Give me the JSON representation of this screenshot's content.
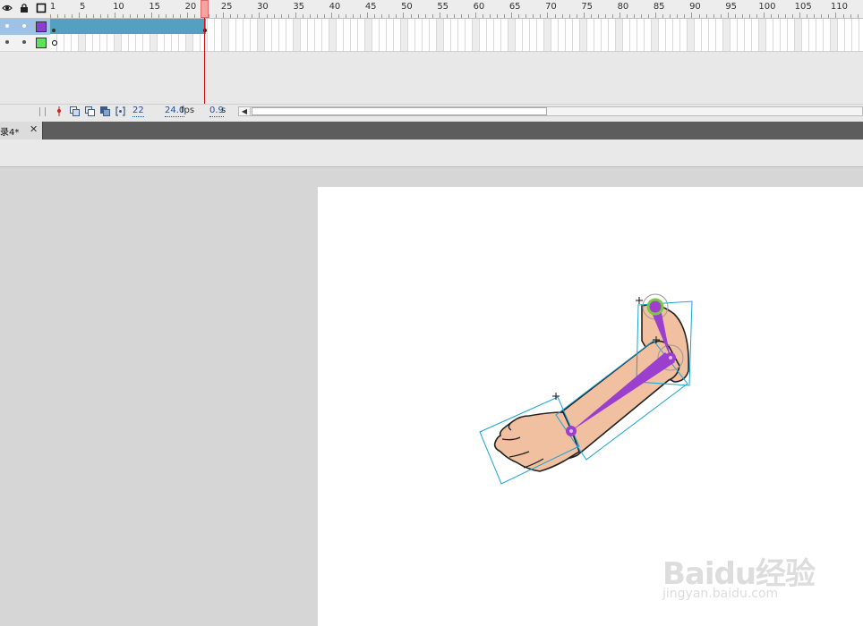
{
  "timeline": {
    "ruler": {
      "labels": [
        "1",
        "5",
        "10",
        "15",
        "20",
        "25",
        "30",
        "35",
        "40",
        "45",
        "50",
        "55",
        "60",
        "65",
        "70",
        "75",
        "80",
        "85",
        "90",
        "95",
        "100",
        "105",
        "110"
      ],
      "frames": [
        1,
        5,
        10,
        15,
        20,
        25,
        30,
        35,
        40,
        45,
        50,
        55,
        60,
        65,
        70,
        75,
        80,
        85,
        90,
        95,
        100,
        105,
        110
      ]
    },
    "header_icons": [
      "eye-icon",
      "lock-icon",
      "outline-icon"
    ],
    "layers": [
      {
        "color": "#8b3fd0",
        "selected": true,
        "tween_end_frame": 22
      },
      {
        "color": "#5fe05f",
        "selected": false
      }
    ],
    "current_frame_indicator": 22,
    "status": {
      "current_frame": "22",
      "fps_value": "24.0",
      "fps_unit": "fps",
      "time_value": "0.9",
      "time_unit": "s"
    }
  },
  "document_tab": {
    "label": "录4*",
    "close_glyph": "✕"
  },
  "stage": {
    "background": "#ffffff",
    "armature_color": "#9b3fcf",
    "joint_highlight_color": "#7ac943",
    "bounding_box_color": "#1aa3d6",
    "skin_color": "#f0c0a0"
  },
  "watermark": {
    "logo": "Baidu经验",
    "url": "jingyan.baidu.com"
  }
}
